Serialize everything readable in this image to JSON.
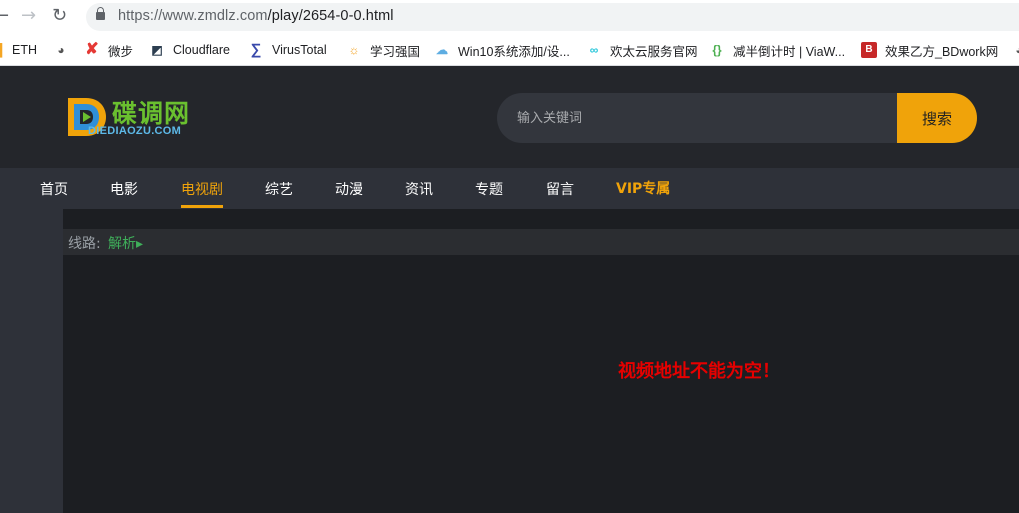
{
  "browser": {
    "url_domain": "https://www.zmdlz.com",
    "url_path": "/play/2654-0-0.html",
    "back_icon": "back-arrow-icon",
    "forward_icon": "forward-arrow-icon",
    "reload_icon": "reload-icon"
  },
  "bookmarks": [
    {
      "label": "ETH",
      "icon": "eth-icon",
      "color": "#f5a623"
    },
    {
      "label": "微步",
      "icon": "x-icon",
      "color": "#e53935"
    },
    {
      "label": "Cloudflare",
      "icon": "cloudflare-icon",
      "color": "#2c3e50"
    },
    {
      "label": "VirusTotal",
      "icon": "virustotal-icon",
      "color": "#3949ab"
    },
    {
      "label": "学习强国",
      "icon": "bulb-icon",
      "color": "#f39c12"
    },
    {
      "label": "Win10系统添加/设...",
      "icon": "cloud-icon",
      "color": "#5dade2"
    },
    {
      "label": "欢太云服务官网",
      "icon": "link-icon",
      "color": "#26c6da"
    },
    {
      "label": "减半倒计时 | ViaW...",
      "icon": "bracket-icon",
      "color": "#4caf50"
    },
    {
      "label": "效果乙方_BDwork网",
      "icon": "book-icon",
      "color": "#c62828"
    }
  ],
  "site": {
    "logo_cn": "碟调网",
    "logo_en": "DIEDIAOZU.COM",
    "search_placeholder": "输入关键词",
    "search_button": "搜索",
    "accent": "#f0a30a"
  },
  "nav": [
    {
      "label": "首页"
    },
    {
      "label": "电影"
    },
    {
      "label": "电视剧",
      "active": true
    },
    {
      "label": "综艺"
    },
    {
      "label": "动漫"
    },
    {
      "label": "资讯"
    },
    {
      "label": "专题"
    },
    {
      "label": "留言"
    },
    {
      "label": "VIP专属"
    }
  ],
  "player": {
    "line_label": "线路:",
    "line_link": "解析▸",
    "error_message": "视频地址不能为空！"
  }
}
